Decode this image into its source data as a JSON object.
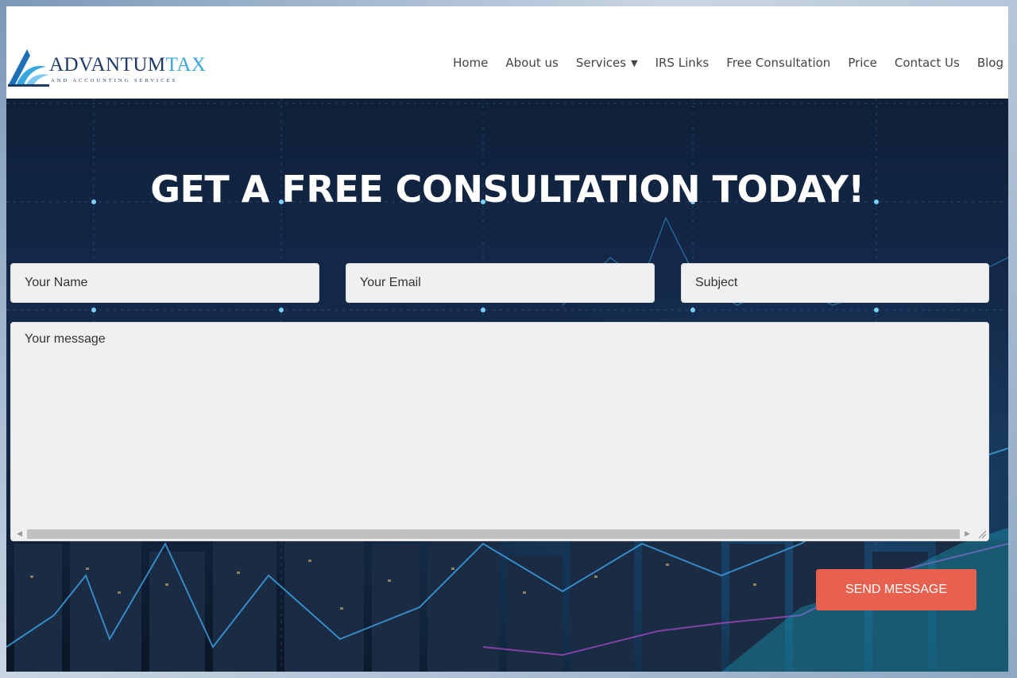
{
  "brand": {
    "name_part1": "ADVANTUM",
    "name_part2": "TAX",
    "tagline": "AND ACCOUNTING SERVICES",
    "colors": {
      "dark_blue": "#1d3a66",
      "light_blue": "#38a7e0"
    }
  },
  "nav": {
    "items": [
      {
        "label": "Home"
      },
      {
        "label": "About us"
      },
      {
        "label": "Services",
        "has_dropdown": true,
        "icon": "caret-down-icon"
      },
      {
        "label": "IRS Links"
      },
      {
        "label": "Free Consultation"
      },
      {
        "label": "Price"
      },
      {
        "label": "Contact Us"
      },
      {
        "label": "Blog"
      }
    ]
  },
  "hero": {
    "headline": "GET A FREE CONSULTATION TODAY!"
  },
  "form": {
    "name_placeholder": "Your Name",
    "email_placeholder": "Your Email",
    "subject_placeholder": "Subject",
    "message_placeholder": "Your message",
    "submit_label": "SEND MESSAGE"
  },
  "colors": {
    "accent": "#e8604e",
    "field_bg": "#eff0f1",
    "header_bg": "#ffffff"
  }
}
